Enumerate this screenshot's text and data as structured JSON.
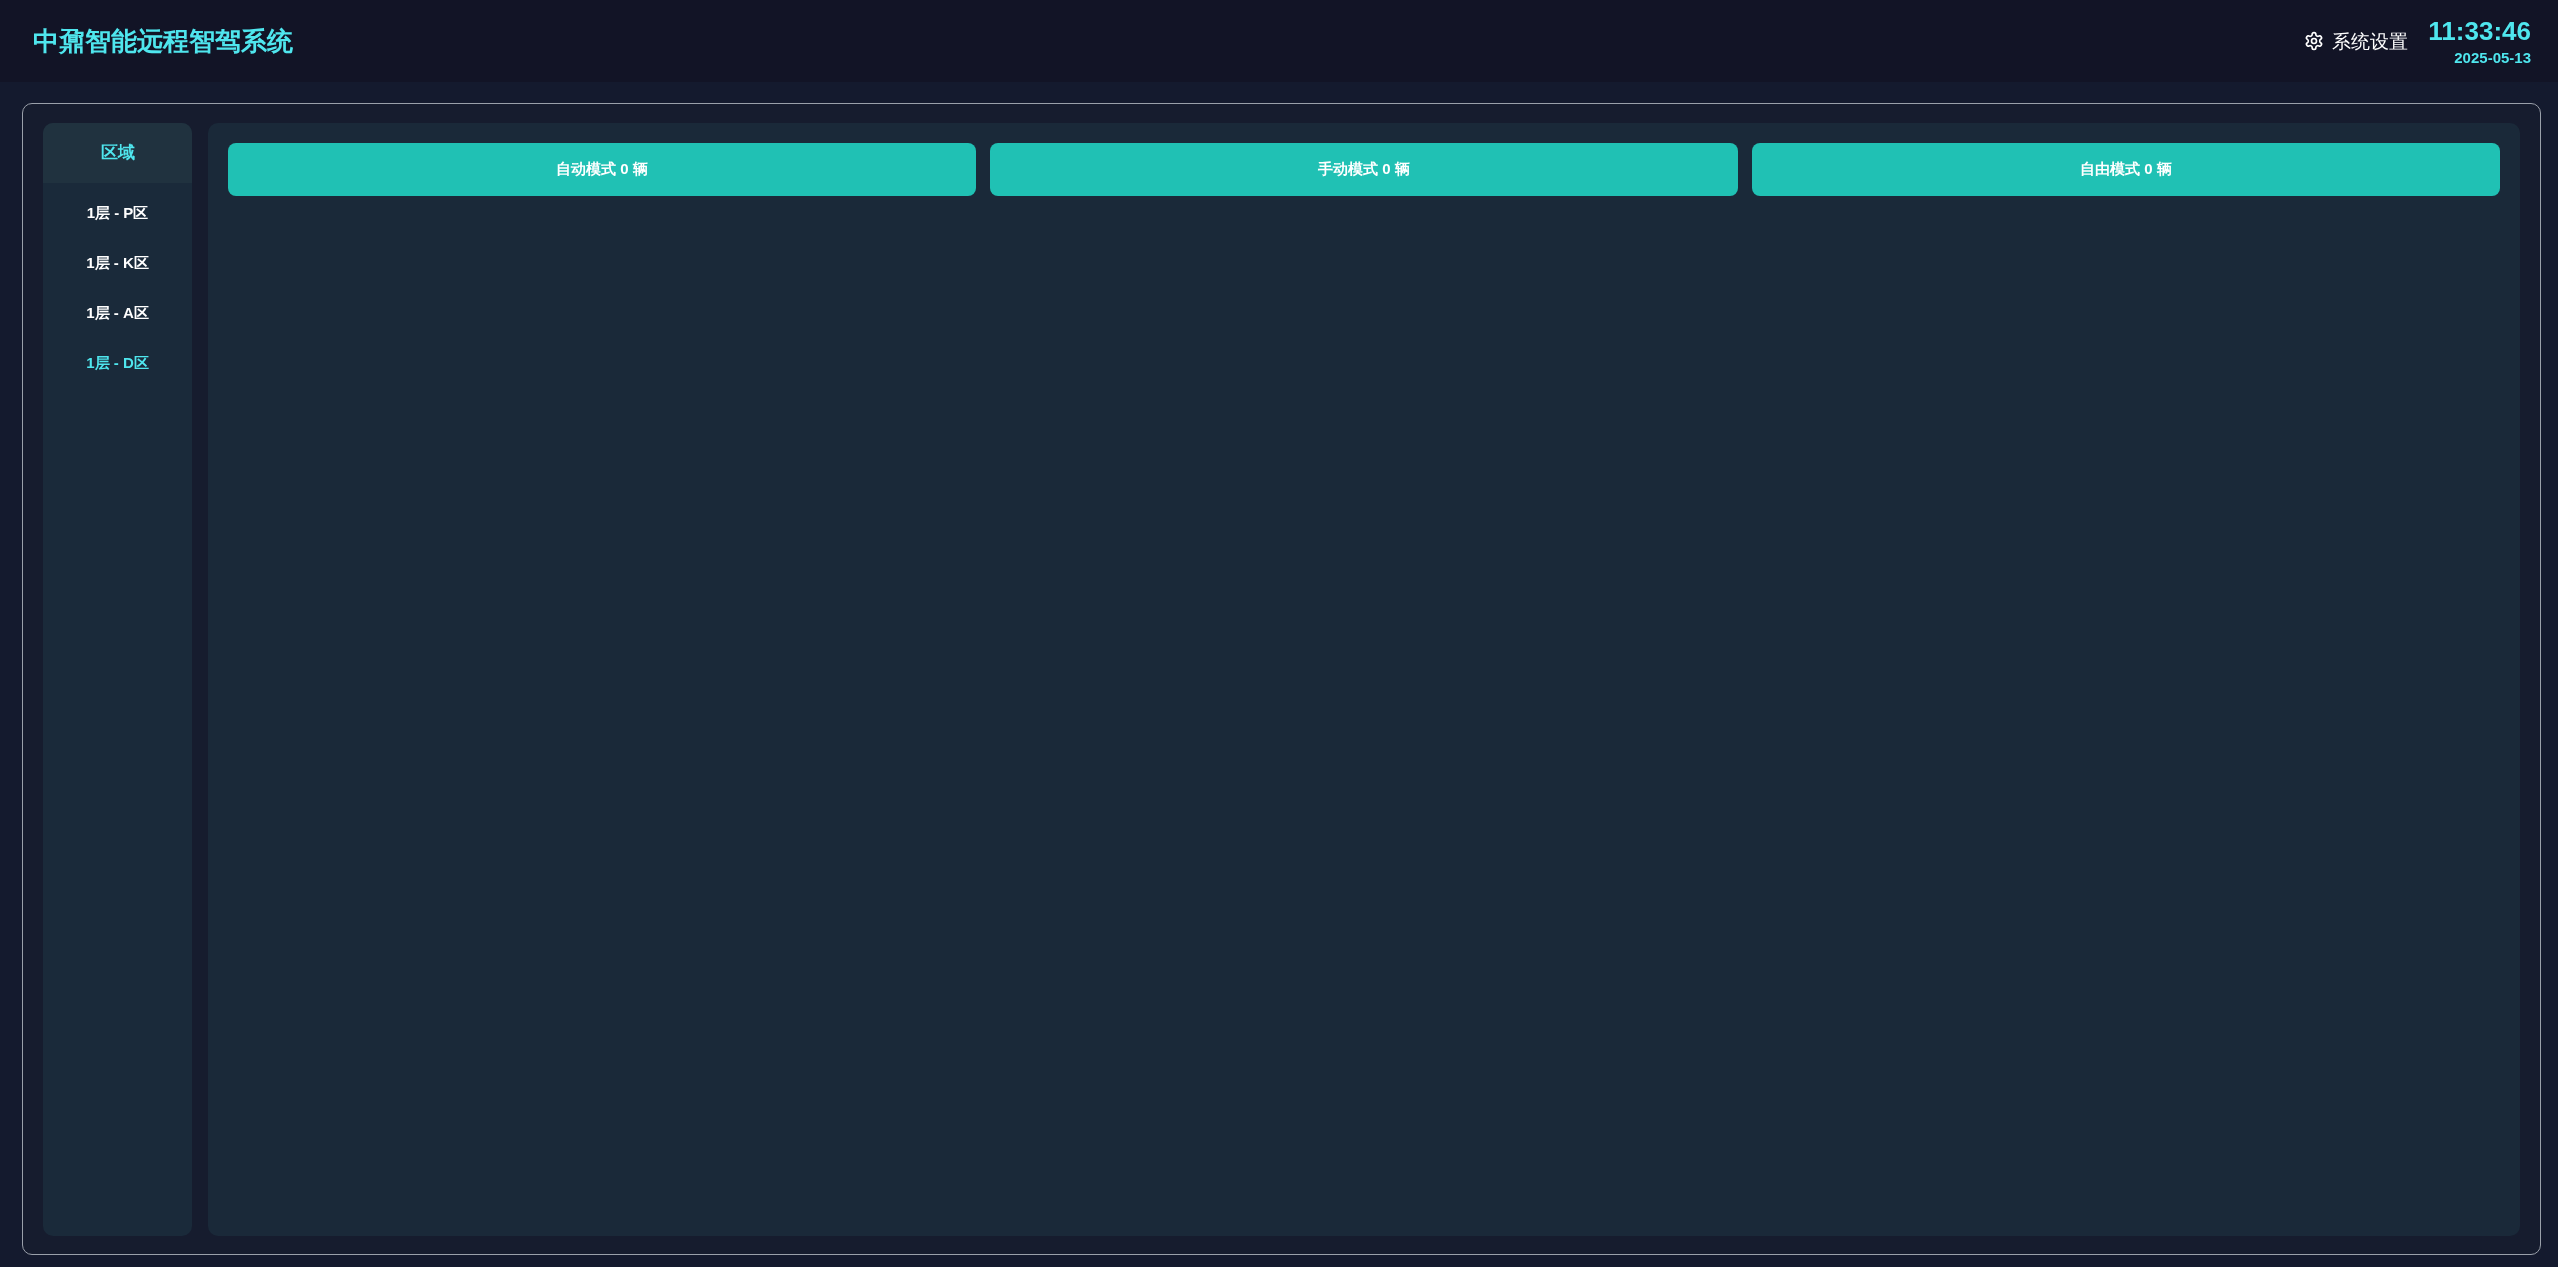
{
  "header": {
    "title": "中鼐智能远程智驾系统",
    "settings": {
      "label": "系统设置"
    },
    "time": "11:33:46",
    "date": "2025-05-13"
  },
  "sidebar": {
    "title": "区域",
    "items": [
      {
        "label": "1层 - P区",
        "selected": false
      },
      {
        "label": "1层 - K区",
        "selected": false
      },
      {
        "label": "1层 - A区",
        "selected": false
      },
      {
        "label": "1层 - D区",
        "selected": true
      }
    ]
  },
  "mode_buttons": [
    {
      "label": "自动模式 0 辆"
    },
    {
      "label": "手动模式 0 辆"
    },
    {
      "label": "自由模式 0 辆"
    }
  ]
}
